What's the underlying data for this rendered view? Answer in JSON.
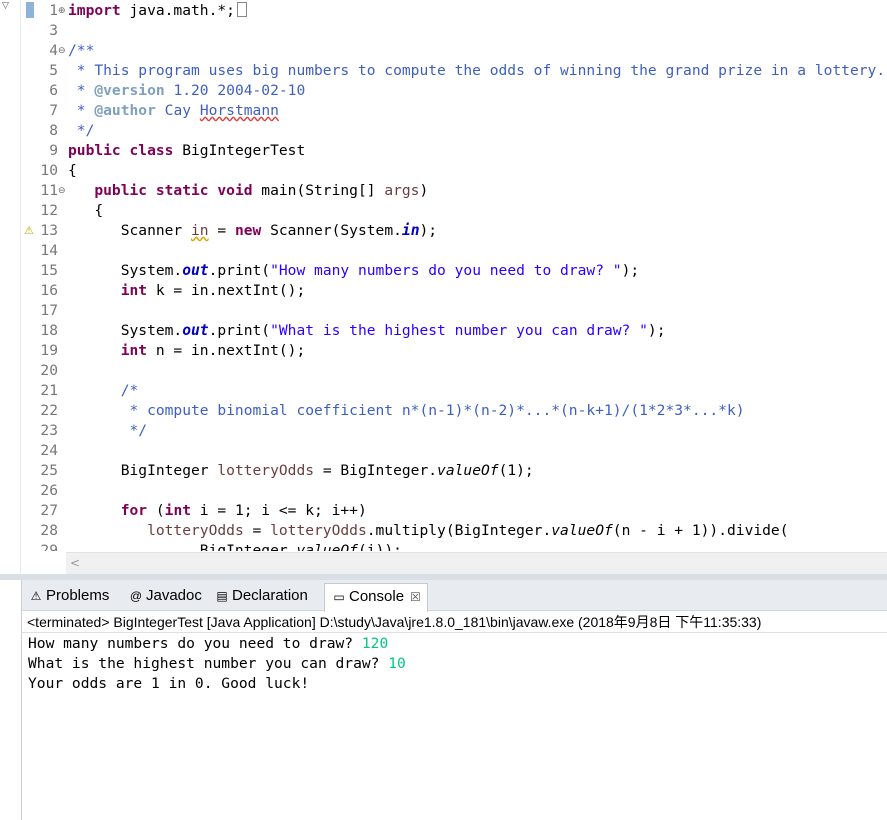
{
  "editor": {
    "lines": [
      {
        "n": "1",
        "fold": "⊕",
        "marker": true,
        "segs": [
          [
            "kw",
            "import"
          ],
          [
            "",
            "java.math.*;"
          ]
        ],
        "box": true
      },
      {
        "n": "3",
        "segs": []
      },
      {
        "n": "4",
        "fold": "⊖",
        "segs": [
          [
            "cm",
            "/**"
          ]
        ]
      },
      {
        "n": "5",
        "segs": [
          [
            "cm",
            " * This program uses big numbers to compute the odds of winning the grand prize in a lottery."
          ]
        ]
      },
      {
        "n": "6",
        "segs": [
          [
            "cm",
            " * "
          ],
          [
            "jd",
            "@version"
          ],
          [
            "cm",
            " 1.20 2004-02-10"
          ]
        ]
      },
      {
        "n": "7",
        "segs": [
          [
            "cm",
            " * "
          ],
          [
            "jd",
            "@author"
          ],
          [
            "cm",
            " Cay "
          ],
          [
            "cm sqr",
            "Horstmann"
          ]
        ]
      },
      {
        "n": "8",
        "segs": [
          [
            "cm",
            " */"
          ]
        ]
      },
      {
        "n": "9",
        "segs": [
          [
            "kw",
            "public class"
          ],
          [
            "",
            " BigIntegerTest"
          ]
        ]
      },
      {
        "n": "10",
        "segs": [
          [
            "",
            "{"
          ]
        ]
      },
      {
        "n": "11",
        "fold": "⊖",
        "segs": [
          [
            "",
            "   "
          ],
          [
            "kw",
            "public static void"
          ],
          [
            "",
            " main(String[] "
          ],
          [
            "var",
            "args"
          ],
          [
            "",
            ")"
          ]
        ]
      },
      {
        "n": "12",
        "segs": [
          [
            "",
            "   {"
          ]
        ]
      },
      {
        "n": "13",
        "warn": true,
        "segs": [
          [
            "",
            "      Scanner "
          ],
          [
            "var sq",
            "in"
          ],
          [
            "",
            " = "
          ],
          [
            "kw",
            "new"
          ],
          [
            "",
            " Scanner(System."
          ],
          [
            "fld",
            "in"
          ],
          [
            "",
            ");"
          ]
        ]
      },
      {
        "n": "14",
        "segs": []
      },
      {
        "n": "15",
        "segs": [
          [
            "",
            "      System."
          ],
          [
            "fld",
            "out"
          ],
          [
            "",
            ".print("
          ],
          [
            "str",
            "\"How many numbers do you need to draw? \""
          ],
          [
            "",
            ");"
          ]
        ]
      },
      {
        "n": "16",
        "segs": [
          [
            "",
            "      "
          ],
          [
            "kw",
            "int"
          ],
          [
            "",
            " k = in.nextInt();"
          ]
        ]
      },
      {
        "n": "17",
        "segs": []
      },
      {
        "n": "18",
        "segs": [
          [
            "",
            "      System."
          ],
          [
            "fld",
            "out"
          ],
          [
            "",
            ".print("
          ],
          [
            "str",
            "\"What is the highest number you can draw? \""
          ],
          [
            "",
            ");"
          ]
        ]
      },
      {
        "n": "19",
        "segs": [
          [
            "",
            "      "
          ],
          [
            "kw",
            "int"
          ],
          [
            "",
            " n = in.nextInt();"
          ]
        ]
      },
      {
        "n": "20",
        "segs": []
      },
      {
        "n": "21",
        "segs": [
          [
            "cm",
            "      /*"
          ]
        ]
      },
      {
        "n": "22",
        "segs": [
          [
            "cm",
            "       * compute binomial coefficient n*(n-1)*(n-2)*...*(n-k+1)/(1*2*3*...*k)"
          ]
        ]
      },
      {
        "n": "23",
        "segs": [
          [
            "cm",
            "       */"
          ]
        ]
      },
      {
        "n": "24",
        "segs": []
      },
      {
        "n": "25",
        "segs": [
          [
            "",
            "      BigInteger "
          ],
          [
            "var",
            "lotteryOdds"
          ],
          [
            "",
            " = BigInteger."
          ],
          [
            "stat",
            "valueOf"
          ],
          [
            "",
            "(1);"
          ]
        ]
      },
      {
        "n": "26",
        "segs": []
      },
      {
        "n": "27",
        "segs": [
          [
            "",
            "      "
          ],
          [
            "kw",
            "for"
          ],
          [
            "",
            " ("
          ],
          [
            "kw",
            "int"
          ],
          [
            "",
            " i = 1; i <= k; i++)"
          ]
        ]
      },
      {
        "n": "28",
        "segs": [
          [
            "",
            "         "
          ],
          [
            "var",
            "lotteryOdds"
          ],
          [
            "",
            " = "
          ],
          [
            "var",
            "lotteryOdds"
          ],
          [
            "",
            ".multiply(BigInteger."
          ],
          [
            "stat",
            "valueOf"
          ],
          [
            "",
            "(n - i + 1)).divide("
          ]
        ]
      },
      {
        "n": "29",
        "segs": [
          [
            "",
            "               BigInteger."
          ],
          [
            "stat",
            "valueOf"
          ],
          [
            "",
            "(i));"
          ]
        ]
      }
    ],
    "hscroll_left": "<"
  },
  "panel": {
    "tabs": [
      {
        "id": "problems",
        "icon": "problems-icon",
        "glyph": "⚠",
        "label": "Problems"
      },
      {
        "id": "javadoc",
        "icon": "javadoc-icon",
        "glyph": "@",
        "label": "Javadoc"
      },
      {
        "id": "declaration",
        "icon": "declaration-icon",
        "glyph": "▤",
        "label": "Declaration"
      },
      {
        "id": "console",
        "icon": "console-icon",
        "glyph": "▭",
        "label": "Console",
        "active": true
      }
    ],
    "console_close": "☒",
    "status": "<terminated> BigIntegerTest [Java Application] D:\\study\\Java\\jre1.8.0_181\\bin\\javaw.exe (2018年9月8日 下午11:35:33)",
    "output": [
      {
        "text": "How many numbers do you need to draw? ",
        "input": "120"
      },
      {
        "text": "What is the highest number you can draw? ",
        "input": "10"
      },
      {
        "text": "Your odds are 1 in 0. Good luck!",
        "input": ""
      }
    ]
  },
  "colors": {
    "keyword": "#7f0055",
    "comment": "#3f5fbf",
    "string": "#2a00ff",
    "field": "#0000c0",
    "console_input": "#00c87d"
  }
}
